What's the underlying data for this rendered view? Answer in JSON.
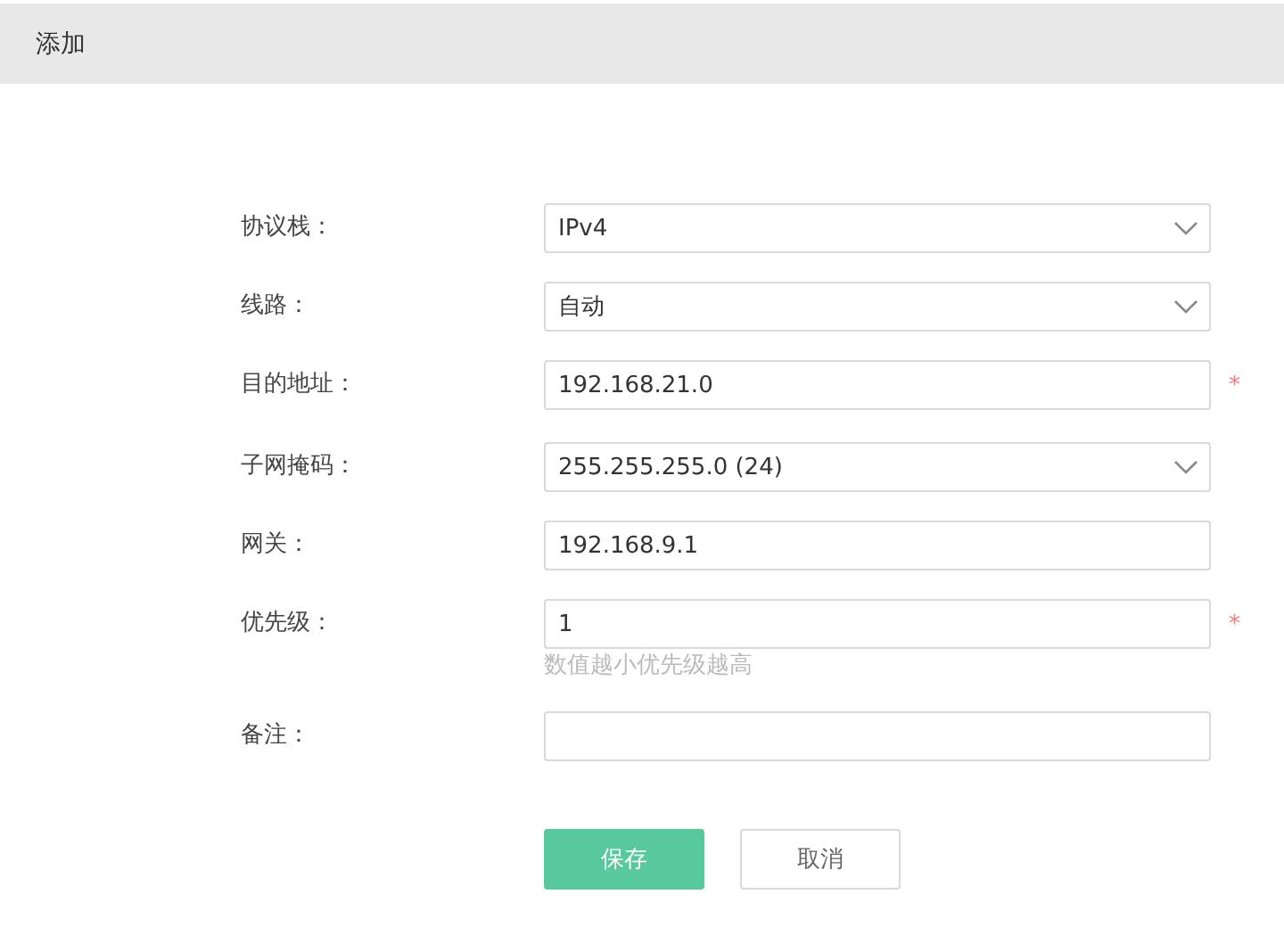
{
  "header": {
    "title": "添加"
  },
  "fields": [
    {
      "label": "协议栈：",
      "kind": "select",
      "value": "IPv4"
    },
    {
      "label": "线路：",
      "kind": "select",
      "value": "自动"
    },
    {
      "label": "目的地址：",
      "kind": "input",
      "value": "192.168.21.0",
      "required_mark": "*"
    },
    {
      "label": "子网掩码：",
      "kind": "select",
      "value": "255.255.255.0 (24)"
    },
    {
      "label": "网关：",
      "kind": "input",
      "value": "192.168.9.1"
    },
    {
      "label": "优先级：",
      "kind": "input",
      "value": "1",
      "required_mark": "*",
      "hint": "数值越小优先级越高"
    },
    {
      "label": "备注：",
      "kind": "input"
    }
  ],
  "buttons": [
    {
      "label": "保存",
      "kind": "primary"
    },
    {
      "label": "取消",
      "kind": "default"
    }
  ]
}
